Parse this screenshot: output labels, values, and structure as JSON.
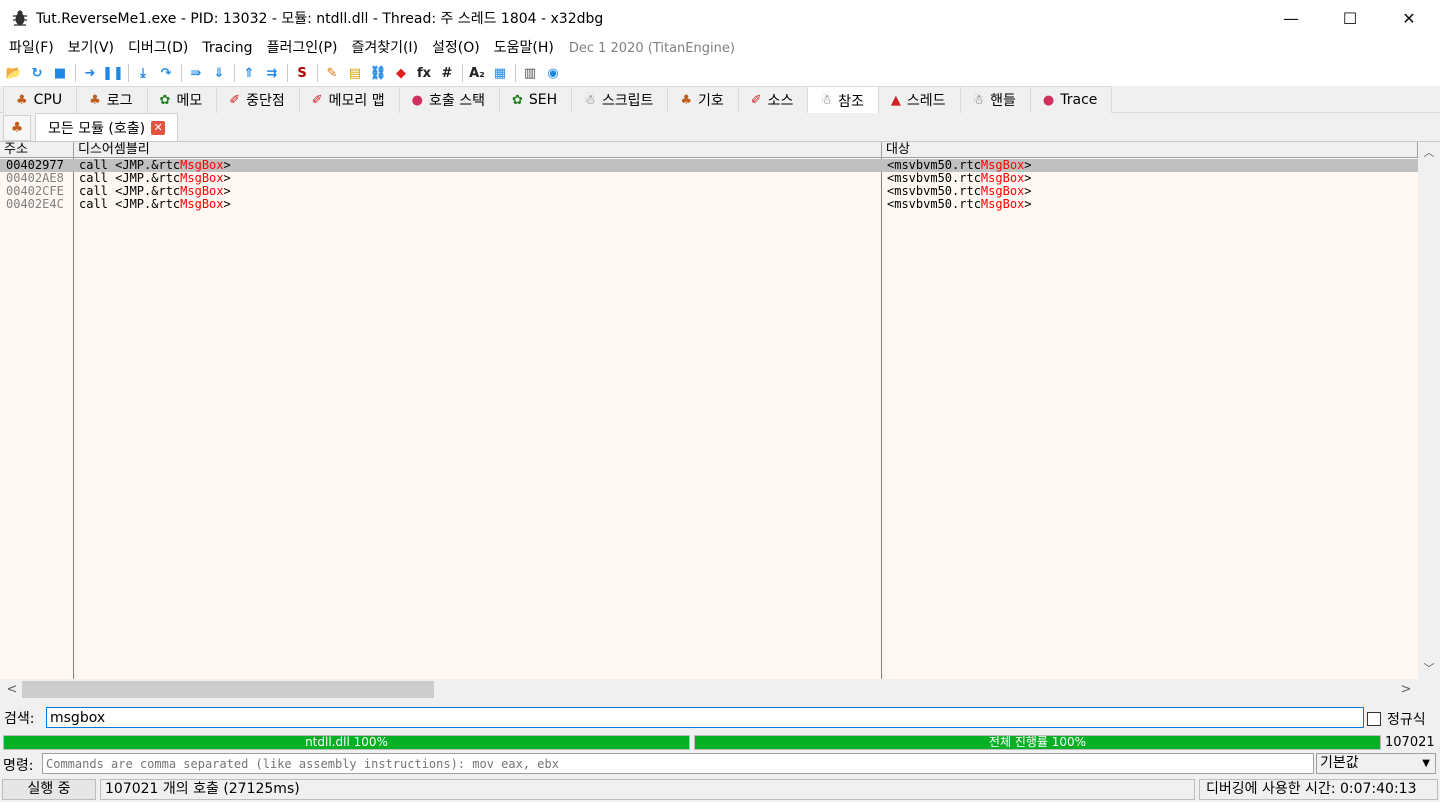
{
  "window": {
    "title": "Tut.ReverseMe1.exe - PID: 13032 - 모듈: ntdll.dll - Thread: 주 스레드 1804 - x32dbg",
    "minimize": "—",
    "maximize": "☐",
    "close": "✕"
  },
  "menu": {
    "items": [
      "파일(F)",
      "보기(V)",
      "디버그(D)",
      "Tracing",
      "플러그인(P)",
      "즐겨찾기(I)",
      "설정(O)",
      "도움말(H)"
    ],
    "build_info": "Dec 1 2020 (TitanEngine)"
  },
  "toolbar": {
    "buttons": [
      {
        "icon": "open-folder-icon",
        "glyph": "📂",
        "color": "#e8b000"
      },
      {
        "icon": "restart-icon",
        "glyph": "↻",
        "color": "#1e88e5"
      },
      {
        "icon": "stop-icon",
        "glyph": "■",
        "color": "#1e88e5"
      },
      {
        "icon": "run-icon",
        "glyph": "➜",
        "color": "#1e88e5"
      },
      {
        "icon": "pause-icon",
        "glyph": "❚❚",
        "color": "#1e88e5"
      },
      {
        "icon": "step-into-icon",
        "glyph": "⤓",
        "color": "#1e88e5"
      },
      {
        "icon": "step-over-icon",
        "glyph": "↷",
        "color": "#1e88e5"
      },
      {
        "icon": "trace-into-icon",
        "glyph": "⇛",
        "color": "#1e88e5"
      },
      {
        "icon": "trace-over-icon",
        "glyph": "⇓",
        "color": "#1e88e5"
      },
      {
        "icon": "execute-till-return-icon",
        "glyph": "⇑",
        "color": "#1e88e5"
      },
      {
        "icon": "run-to-user-code-icon",
        "glyph": "⇉",
        "color": "#1e88e5"
      },
      {
        "icon": "script-icon",
        "glyph": "S",
        "color": "#b00000"
      },
      {
        "icon": "patch-icon",
        "glyph": "✎",
        "color": "#e07000"
      },
      {
        "icon": "comments-icon",
        "glyph": "▤",
        "color": "#d0a000"
      },
      {
        "icon": "labels-icon",
        "glyph": "⛓",
        "color": "#1e88e5"
      },
      {
        "icon": "bookmarks-icon",
        "glyph": "◆",
        "color": "#e02020"
      },
      {
        "icon": "functions-icon",
        "glyph": "fx",
        "color": "#202020"
      },
      {
        "icon": "variables-icon",
        "glyph": "#",
        "color": "#202020"
      },
      {
        "icon": "strings-icon",
        "glyph": "A₂",
        "color": "#202020"
      },
      {
        "icon": "document-icon",
        "glyph": "▦",
        "color": "#1e88e5"
      },
      {
        "icon": "calculator-icon",
        "glyph": "▥",
        "color": "#505050"
      },
      {
        "icon": "globe-icon",
        "glyph": "◉",
        "color": "#1e88e5"
      }
    ]
  },
  "tabs": [
    {
      "label": "CPU",
      "icon": "cpu-tab-icon",
      "glyph": "♣",
      "color": "#c06020",
      "active": false
    },
    {
      "label": "로그",
      "icon": "log-tab-icon",
      "glyph": "♣",
      "color": "#c06020",
      "active": false
    },
    {
      "label": "메모",
      "icon": "notes-tab-icon",
      "glyph": "✿",
      "color": "#208020",
      "active": false
    },
    {
      "label": "중단점",
      "icon": "breakpoints-tab-icon",
      "glyph": "✐",
      "color": "#d02020",
      "active": false
    },
    {
      "label": "메모리 맵",
      "icon": "memory-map-tab-icon",
      "glyph": "✐",
      "color": "#d02020",
      "active": false
    },
    {
      "label": "호출 스택",
      "icon": "call-stack-tab-icon",
      "glyph": "●",
      "color": "#d03060",
      "active": false
    },
    {
      "label": "SEH",
      "icon": "seh-tab-icon",
      "glyph": "✿",
      "color": "#208020",
      "active": false
    },
    {
      "label": "스크립트",
      "icon": "script-tab-icon",
      "glyph": "☃",
      "color": "#606060",
      "active": false
    },
    {
      "label": "기호",
      "icon": "symbols-tab-icon",
      "glyph": "♣",
      "color": "#c06020",
      "active": false
    },
    {
      "label": "소스",
      "icon": "source-tab-icon",
      "glyph": "✐",
      "color": "#d02020",
      "active": false
    },
    {
      "label": "참조",
      "icon": "references-tab-icon",
      "glyph": "☃",
      "color": "#606060",
      "active": true
    },
    {
      "label": "스레드",
      "icon": "threads-tab-icon",
      "glyph": "▲",
      "color": "#d02020",
      "active": false
    },
    {
      "label": "핸들",
      "icon": "handles-tab-icon",
      "glyph": "☃",
      "color": "#606060",
      "active": false
    },
    {
      "label": "Trace",
      "icon": "trace-tab-icon",
      "glyph": "●",
      "color": "#d03060",
      "active": false
    }
  ],
  "subtabs": {
    "icon_glyph": "♣",
    "label": "모든 모듈 (호출)",
    "close": "✕"
  },
  "table": {
    "headers": [
      "주소",
      "디스어셈블리",
      "대상"
    ],
    "rows": [
      {
        "address": "00402977",
        "disasm_prefix": "call <JMP.&rtc",
        "disasm_highlight": "MsgBox",
        "disasm_suffix": ">",
        "target_prefix": "<msvbvm50.rtc",
        "target_highlight": "MsgBox",
        "target_suffix": ">",
        "selected": true
      },
      {
        "address": "00402AE8",
        "disasm_prefix": "call <JMP.&rtc",
        "disasm_highlight": "MsgBox",
        "disasm_suffix": ">",
        "target_prefix": "<msvbvm50.rtc",
        "target_highlight": "MsgBox",
        "target_suffix": ">",
        "selected": false
      },
      {
        "address": "00402CFE",
        "disasm_prefix": "call <JMP.&rtc",
        "disasm_highlight": "MsgBox",
        "disasm_suffix": ">",
        "target_prefix": "<msvbvm50.rtc",
        "target_highlight": "MsgBox",
        "target_suffix": ">",
        "selected": false
      },
      {
        "address": "00402E4C",
        "disasm_prefix": "call <JMP.&rtc",
        "disasm_highlight": "MsgBox",
        "disasm_suffix": ">",
        "target_prefix": "<msvbvm50.rtc",
        "target_highlight": "MsgBox",
        "target_suffix": ">",
        "selected": false
      }
    ]
  },
  "scroll": {
    "up": "︿",
    "down": "﹀",
    "left": "<",
    "right": ">"
  },
  "search": {
    "label": "검색:",
    "value": "msgbox",
    "regex_label": "정규식"
  },
  "progress": {
    "module_label": "ntdll.dll 100%",
    "module_percent": 100,
    "total_label": "전체 진행률 100%",
    "total_percent": 100,
    "count": "107021",
    "color": "#06b025"
  },
  "command": {
    "label": "명령:",
    "placeholder": "Commands are comma separated (like assembly instructions): mov eax, ebx",
    "mode": "기본값",
    "mode_arrow": "▼"
  },
  "status": {
    "state": "실행 중",
    "message": "107021 개의 호출 (27125ms)",
    "time": "디버깅에 사용한 시간: 0:07:40:13"
  }
}
